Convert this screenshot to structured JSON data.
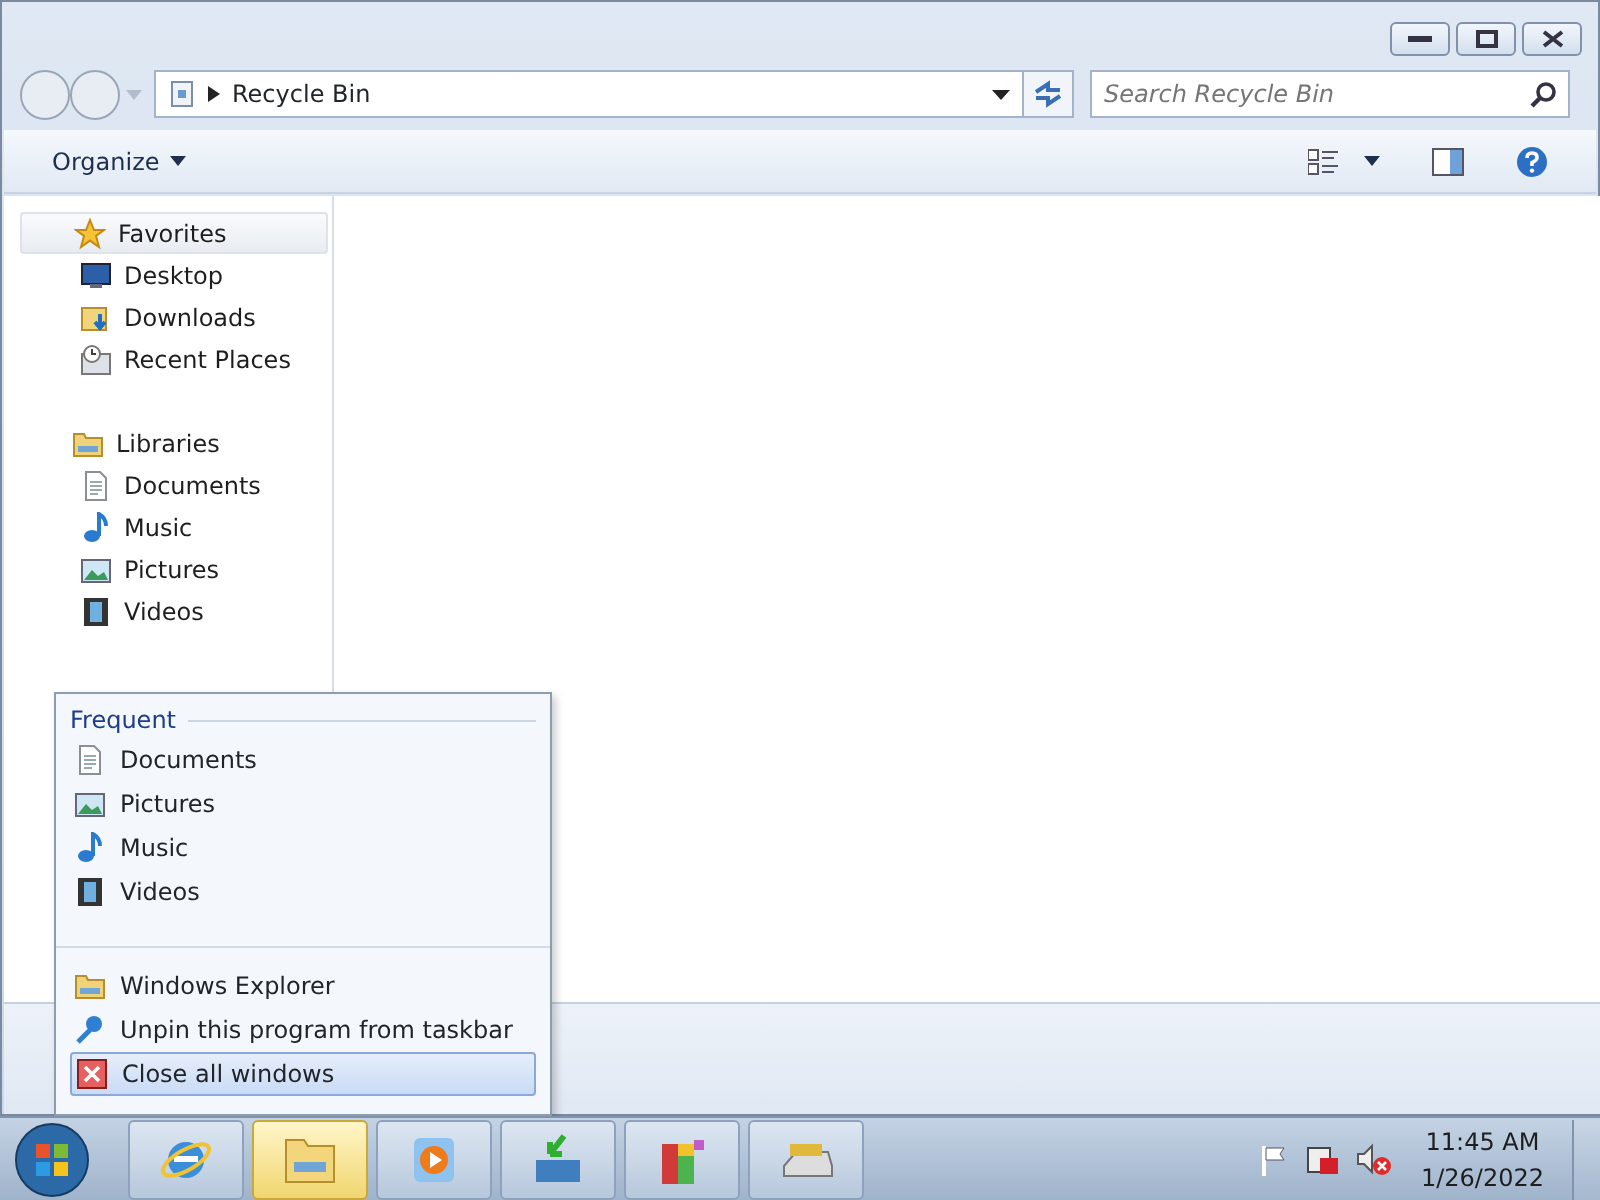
{
  "window": {
    "address": "Recycle Bin",
    "search_placeholder": "Search Recycle Bin"
  },
  "toolbar": {
    "organize": "Organize"
  },
  "navigation": [
    {
      "label": "Favorites",
      "kind": "star",
      "selected": true,
      "children": [
        {
          "label": "Desktop",
          "kind": "desktop"
        },
        {
          "label": "Downloads",
          "kind": "downloads"
        },
        {
          "label": "Recent Places",
          "kind": "recent"
        }
      ]
    },
    {
      "label": "Libraries",
      "kind": "library",
      "selected": false,
      "children": [
        {
          "label": "Documents",
          "kind": "documents"
        },
        {
          "label": "Music",
          "kind": "music"
        },
        {
          "label": "Pictures",
          "kind": "pictures"
        },
        {
          "label": "Videos",
          "kind": "videos"
        }
      ]
    }
  ],
  "jump_list": {
    "heading": "Frequent",
    "frequent": [
      {
        "label": "Documents",
        "kind": "documents"
      },
      {
        "label": "Pictures",
        "kind": "pictures"
      },
      {
        "label": "Music",
        "kind": "music"
      },
      {
        "label": "Videos",
        "kind": "videos"
      }
    ],
    "tasks": [
      {
        "label": "Windows Explorer",
        "kind": "library",
        "selected": false
      },
      {
        "label": "Unpin this program from taskbar",
        "kind": "unpin",
        "selected": false
      },
      {
        "label": "Close all windows",
        "kind": "close",
        "selected": true
      }
    ]
  },
  "taskbar": {
    "buttons": [
      {
        "kind": "browser",
        "selected": false
      },
      {
        "kind": "library",
        "selected": true
      },
      {
        "kind": "media",
        "selected": false
      },
      {
        "kind": "install",
        "selected": false
      },
      {
        "kind": "blocks",
        "selected": false
      },
      {
        "kind": "drive",
        "selected": false
      }
    ],
    "time": "11:45 AM",
    "date": "1/26/2022"
  }
}
